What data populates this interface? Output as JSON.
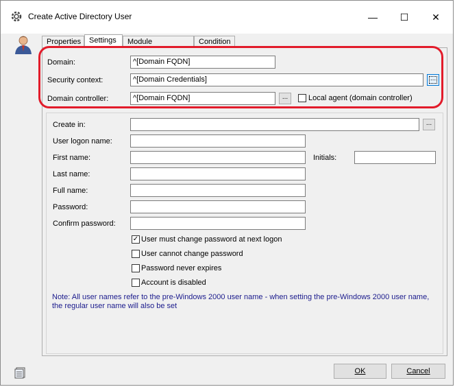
{
  "window": {
    "title": "Create Active Directory User",
    "minimize_glyph": "—",
    "maximize_glyph": "☐",
    "close_glyph": "✕"
  },
  "tabs": [
    {
      "label": "Properties"
    },
    {
      "label": "Settings"
    },
    {
      "label": "Module Parameters"
    },
    {
      "label": "Condition"
    }
  ],
  "connection": {
    "domain_label": "Domain:",
    "domain_value": "^[Domain FQDN]",
    "security_label": "Security context:",
    "security_value": "^[Domain Credentials]",
    "dc_label": "Domain controller:",
    "dc_value": "^[Domain FQDN]",
    "browse_glyph": "...",
    "local_agent_label": "Local agent (domain controller)"
  },
  "user": {
    "create_in_label": "Create in:",
    "create_in_value": "",
    "logon_label": "User logon name:",
    "first_label": "First name:",
    "initials_label": "Initials:",
    "last_label": "Last name:",
    "full_label": "Full name:",
    "password_label": "Password:",
    "confirm_label": "Confirm password:"
  },
  "options": [
    {
      "label": "User must change password at next logon",
      "checked": true
    },
    {
      "label": "User cannot change password",
      "checked": false
    },
    {
      "label": "Password never expires",
      "checked": false
    },
    {
      "label": "Account is disabled",
      "checked": false
    }
  ],
  "note": {
    "line1": "Note: All user names refer to the pre-Windows 2000 user name - when setting the pre-Windows 2000 user name,",
    "line2": "the regular user name will also be set"
  },
  "buttons": {
    "ok_label": "OK",
    "cancel_label": "Cancel"
  },
  "checkmark_glyph": "✓",
  "colors": {
    "highlight": "#e21b2a",
    "note_text": "#1a1a8c"
  }
}
